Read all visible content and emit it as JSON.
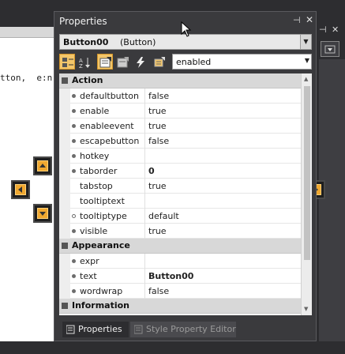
{
  "background": {
    "code_text": "tton,  e:n"
  },
  "panel": {
    "title": "Properties",
    "object_name": "Button00",
    "object_type": "(Button)",
    "filter_value": "enabled"
  },
  "toolbar_icons": [
    "categorized-icon",
    "alphabetical-icon",
    "properties-icon",
    "property-pages-icon",
    "events-icon",
    "style-icon"
  ],
  "categories": [
    {
      "name": "Action",
      "properties": [
        {
          "name": "defaultbutton",
          "value": "false",
          "bold": false,
          "marker": "filled"
        },
        {
          "name": "enable",
          "value": "true",
          "bold": false,
          "marker": "filled"
        },
        {
          "name": "enableevent",
          "value": "true",
          "bold": false,
          "marker": "filled"
        },
        {
          "name": "escapebutton",
          "value": "false",
          "bold": false,
          "marker": "filled"
        },
        {
          "name": "hotkey",
          "value": "",
          "bold": false,
          "marker": "filled"
        },
        {
          "name": "taborder",
          "value": "0",
          "bold": true,
          "marker": "filled"
        },
        {
          "name": "tabstop",
          "value": "true",
          "bold": false,
          "marker": "none"
        },
        {
          "name": "tooltiptext",
          "value": "",
          "bold": false,
          "marker": "none"
        },
        {
          "name": "tooltiptype",
          "value": "default",
          "bold": false,
          "marker": "hollow"
        },
        {
          "name": "visible",
          "value": "true",
          "bold": false,
          "marker": "filled"
        }
      ]
    },
    {
      "name": "Appearance",
      "properties": [
        {
          "name": "expr",
          "value": "",
          "bold": false,
          "marker": "filled"
        },
        {
          "name": "text",
          "value": "Button00",
          "bold": true,
          "marker": "filled"
        },
        {
          "name": "wordwrap",
          "value": "false",
          "bold": false,
          "marker": "filled"
        }
      ]
    },
    {
      "name": "Information",
      "properties": []
    }
  ],
  "tabs": [
    {
      "label": "Properties",
      "active": true
    },
    {
      "label": "Style Property Editor",
      "active": false
    }
  ],
  "colors": {
    "accent": "#f3c66a",
    "dock_guide": "#f0a830",
    "window_chrome": "#3a3a3d"
  }
}
